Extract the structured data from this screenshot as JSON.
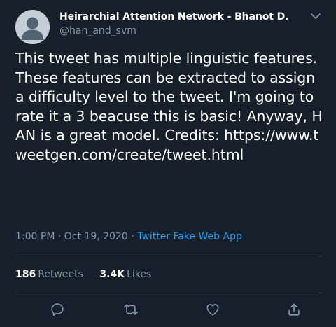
{
  "author": {
    "name": "Heirarchial Attention Network - Bhanot D.",
    "handle": "@han_and_svm"
  },
  "tweet": {
    "text": "This tweet has multiple linguistic features. These features can be extracted to assign a difficulty level to the tweet. I'm going to rate it a 3 beacuse this is basic! Anyway, HAN is a great model. Credits: https://www.tweetgen.com/create/tweet.html"
  },
  "meta": {
    "time": "1:00 PM",
    "separator": "·",
    "date": "Oct 19, 2020",
    "source": "Twitter Fake Web App"
  },
  "stats": {
    "retweets_count": "186",
    "retweets_label": "Retweets",
    "likes_count": "3.4K",
    "likes_label": "Likes"
  },
  "icons": {
    "menu": "chevron-down-icon",
    "reply": "reply-icon",
    "retweet": "retweet-icon",
    "like": "heart-icon",
    "share": "share-icon"
  },
  "colors": {
    "background": "#15202b",
    "text": "#ffffff",
    "secondary": "#8899a6",
    "accent": "#1da1f2",
    "divider": "#38444d",
    "avatar": "#c5ced7"
  }
}
